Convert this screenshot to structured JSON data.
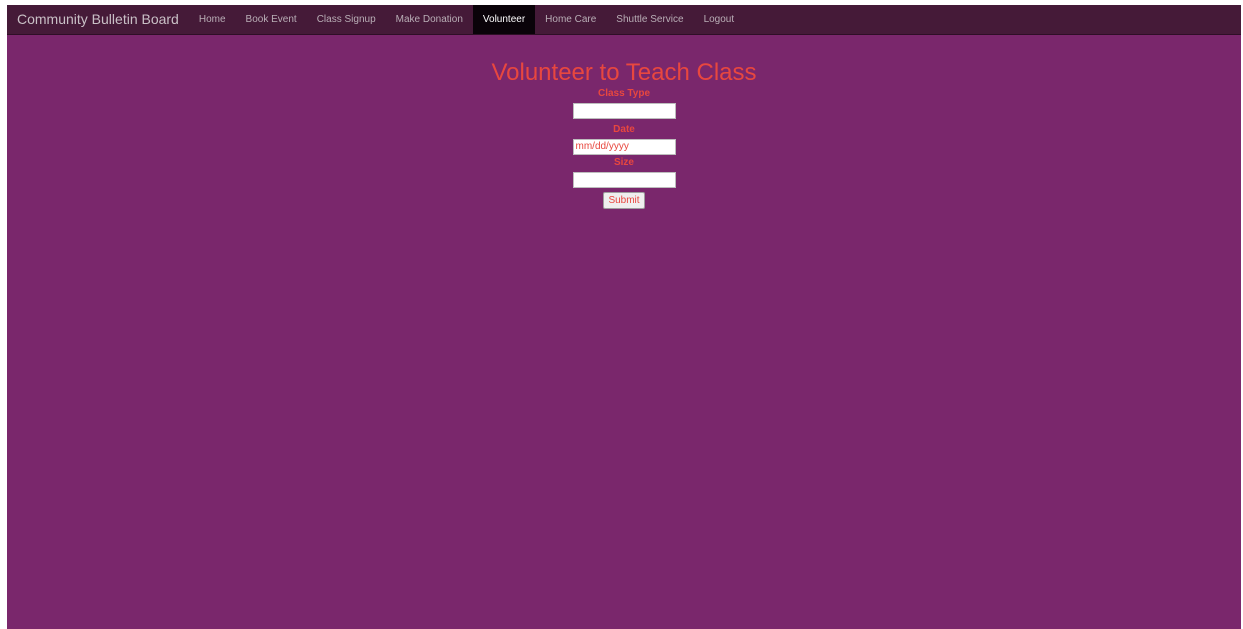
{
  "navbar": {
    "brand": "Community Bulletin Board",
    "items": [
      {
        "label": "Home"
      },
      {
        "label": "Book Event"
      },
      {
        "label": "Class Signup"
      },
      {
        "label": "Make Donation"
      },
      {
        "label": "Volunteer",
        "active": true
      },
      {
        "label": "Home Care"
      },
      {
        "label": "Shuttle Service"
      },
      {
        "label": "Logout"
      }
    ]
  },
  "main": {
    "title": "Volunteer to Teach Class",
    "form": {
      "class_type_label": "Class Type",
      "class_type_value": "",
      "date_label": "Date",
      "date_placeholder": "mm/dd/yyyy",
      "size_label": "Size",
      "size_value": "",
      "submit_label": "Submit"
    }
  },
  "colors": {
    "background": "#7a276c",
    "navbar": "#451a38",
    "accent": "#e8473f",
    "active_tab": "#0a0309"
  }
}
